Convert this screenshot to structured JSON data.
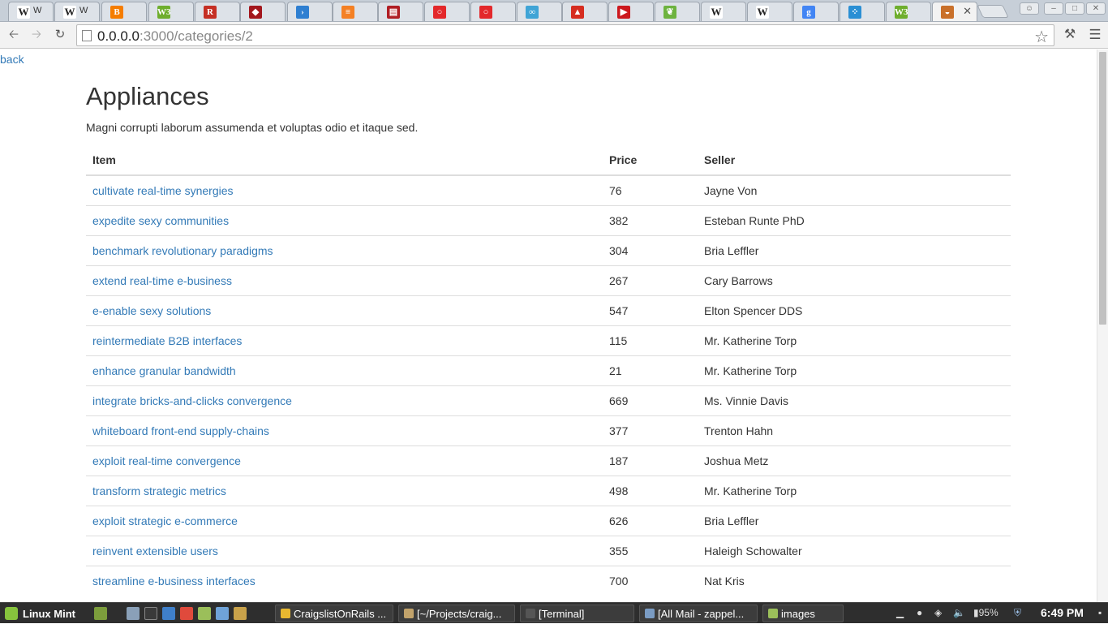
{
  "browser": {
    "tabs": [
      {
        "icon": "wikipedia-icon",
        "glyph": "W",
        "label": "W",
        "color": "#ffffff"
      },
      {
        "icon": "wikipedia-icon",
        "glyph": "W",
        "label": "W",
        "color": "#ffffff"
      },
      {
        "icon": "blogger-icon",
        "glyph": "B",
        "label": "",
        "color": "#f57d00"
      },
      {
        "icon": "w3c-icon",
        "glyph": "W3",
        "label": "",
        "color": "#6eae2d"
      },
      {
        "icon": "rails-guide-icon",
        "glyph": "R",
        "label": "",
        "color": "#c52f24"
      },
      {
        "icon": "shield-icon",
        "glyph": "◆",
        "label": "",
        "color": "#a3171d"
      },
      {
        "icon": "arrow-icon",
        "glyph": "›",
        "label": "",
        "color": "#2e7fd1"
      },
      {
        "icon": "stackoverflow-icon",
        "glyph": "≡",
        "label": "",
        "color": "#f48024"
      },
      {
        "icon": "book-icon",
        "glyph": "▤",
        "label": "",
        "color": "#b01e24"
      },
      {
        "icon": "oracle-icon",
        "glyph": "○",
        "label": "",
        "color": "#e3282b"
      },
      {
        "icon": "oracle-icon",
        "glyph": "○",
        "label": "",
        "color": "#e3282b"
      },
      {
        "icon": "logo-icon",
        "glyph": "∞",
        "label": "",
        "color": "#3fa4d6"
      },
      {
        "icon": "thumbs-up-icon",
        "glyph": "▲",
        "label": "",
        "color": "#d62d20"
      },
      {
        "icon": "youtube-icon",
        "glyph": "▶",
        "label": "",
        "color": "#cc181e"
      },
      {
        "icon": "spring-icon",
        "glyph": "❦",
        "label": "",
        "color": "#6db33f"
      },
      {
        "icon": "wikipedia-icon",
        "glyph": "W",
        "label": "",
        "color": "#ffffff"
      },
      {
        "icon": "wikipedia-icon",
        "glyph": "W",
        "label": "",
        "color": "#ffffff"
      },
      {
        "icon": "google-icon",
        "glyph": "g",
        "label": "",
        "color": "#4285f4"
      },
      {
        "icon": "dots-icon",
        "glyph": "⁘",
        "label": "",
        "color": "#2a8fd4"
      },
      {
        "icon": "w3c-icon",
        "glyph": "W3",
        "label": "",
        "color": "#6eae2d"
      },
      {
        "icon": "rails-app-icon",
        "glyph": "◒",
        "label": "",
        "color": "#c9702a"
      }
    ],
    "url_host": "0.0.0.0",
    "url_rest": ":3000/categories/2"
  },
  "page": {
    "back_label": "back",
    "title": "Appliances",
    "description": "Magni corrupti laborum assumenda et voluptas odio et itaque sed.",
    "columns": {
      "item": "Item",
      "price": "Price",
      "seller": "Seller"
    },
    "rows": [
      {
        "item": "cultivate real-time synergies",
        "price": "76",
        "seller": "Jayne Von"
      },
      {
        "item": "expedite sexy communities",
        "price": "382",
        "seller": "Esteban Runte PhD"
      },
      {
        "item": "benchmark revolutionary paradigms",
        "price": "304",
        "seller": "Bria Leffler"
      },
      {
        "item": "extend real-time e-business",
        "price": "267",
        "seller": "Cary Barrows"
      },
      {
        "item": "e-enable sexy solutions",
        "price": "547",
        "seller": "Elton Spencer DDS"
      },
      {
        "item": "reintermediate B2B interfaces",
        "price": "115",
        "seller": "Mr. Katherine Torp"
      },
      {
        "item": "enhance granular bandwidth",
        "price": "21",
        "seller": "Mr. Katherine Torp"
      },
      {
        "item": "integrate bricks-and-clicks convergence",
        "price": "669",
        "seller": "Ms. Vinnie Davis"
      },
      {
        "item": "whiteboard front-end supply-chains",
        "price": "377",
        "seller": "Trenton Hahn"
      },
      {
        "item": "exploit real-time convergence",
        "price": "187",
        "seller": "Joshua Metz"
      },
      {
        "item": "transform strategic metrics",
        "price": "498",
        "seller": "Mr. Katherine Torp"
      },
      {
        "item": "exploit strategic e-commerce",
        "price": "626",
        "seller": "Bria Leffler"
      },
      {
        "item": "reinvent extensible users",
        "price": "355",
        "seller": "Haleigh Schowalter"
      },
      {
        "item": "streamline e-business interfaces",
        "price": "700",
        "seller": "Nat Kris"
      }
    ]
  },
  "taskbar": {
    "menu_label": "Linux Mint",
    "tasks": [
      {
        "label": "CraigslistOnRails ...",
        "icon": "chrome-icon",
        "color": "#e8b830"
      },
      {
        "label": "[~/Projects/craig...",
        "icon": "file-manager-icon",
        "color": "#c2a36b"
      },
      {
        "label": "[Terminal]",
        "icon": "terminal-icon",
        "color": "#555555"
      },
      {
        "label": "[All Mail - zappel...",
        "icon": "mail-icon",
        "color": "#7a9cc4"
      },
      {
        "label": "images",
        "icon": "folder-icon",
        "color": "#9bbf5a"
      }
    ],
    "battery": "95%",
    "clock": "6:49 PM"
  }
}
